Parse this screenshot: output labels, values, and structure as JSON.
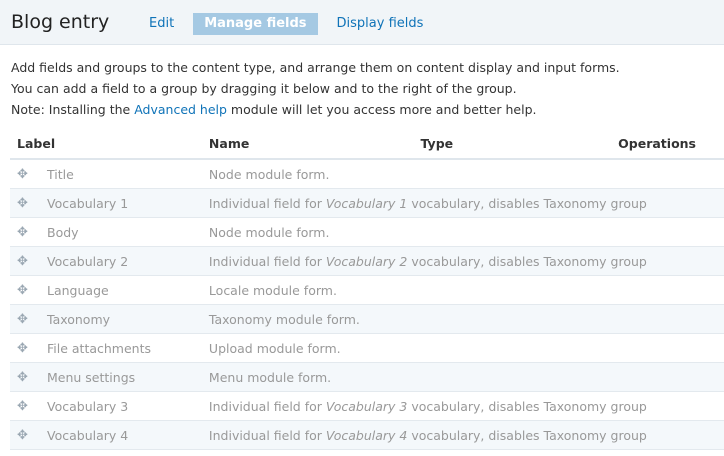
{
  "header": {
    "title": "Blog entry",
    "tabs": [
      {
        "label": "Edit",
        "active": false
      },
      {
        "label": "Manage fields",
        "active": true
      },
      {
        "label": "Display fields",
        "active": false
      }
    ]
  },
  "intro": {
    "line1": "Add fields and groups to the content type, and arrange them on content display and input forms.",
    "line2": "You can add a field to a group by dragging it below and to the right of the group.",
    "line3_before": "Note: Installing the ",
    "line3_link": "Advanced help",
    "line3_after": " module will let you access more and better help."
  },
  "table": {
    "headers": {
      "label": "Label",
      "name": "Name",
      "type": "Type",
      "operations": "Operations"
    },
    "rows": [
      {
        "label": "Title",
        "name_before": "Node module form.",
        "name_italic": "",
        "name_after": ""
      },
      {
        "label": "Vocabulary 1",
        "name_before": "Individual field for ",
        "name_italic": "Vocabulary 1",
        "name_after": " vocabulary, disables Taxonomy group"
      },
      {
        "label": "Body",
        "name_before": "Node module form.",
        "name_italic": "",
        "name_after": ""
      },
      {
        "label": "Vocabulary 2",
        "name_before": "Individual field for ",
        "name_italic": "Vocabulary 2",
        "name_after": " vocabulary, disables Taxonomy group"
      },
      {
        "label": "Language",
        "name_before": "Locale module form.",
        "name_italic": "",
        "name_after": ""
      },
      {
        "label": "Taxonomy",
        "name_before": "Taxonomy module form.",
        "name_italic": "",
        "name_after": ""
      },
      {
        "label": "File attachments",
        "name_before": "Upload module form.",
        "name_italic": "",
        "name_after": ""
      },
      {
        "label": "Menu settings",
        "name_before": "Menu module form.",
        "name_italic": "",
        "name_after": ""
      },
      {
        "label": "Vocabulary 3",
        "name_before": "Individual field for ",
        "name_italic": "Vocabulary 3",
        "name_after": " vocabulary, disables Taxonomy group"
      },
      {
        "label": "Vocabulary 4",
        "name_before": "Individual field for ",
        "name_italic": "Vocabulary 4",
        "name_after": " vocabulary, disables Taxonomy group"
      }
    ]
  },
  "icons": {
    "drag_handle": "move-cross-icon"
  },
  "colors": {
    "link": "#0f73b8",
    "active_tab_bg": "#a5c9e3",
    "row_stripe": "#f4f8fb",
    "muted_text": "#999999"
  }
}
